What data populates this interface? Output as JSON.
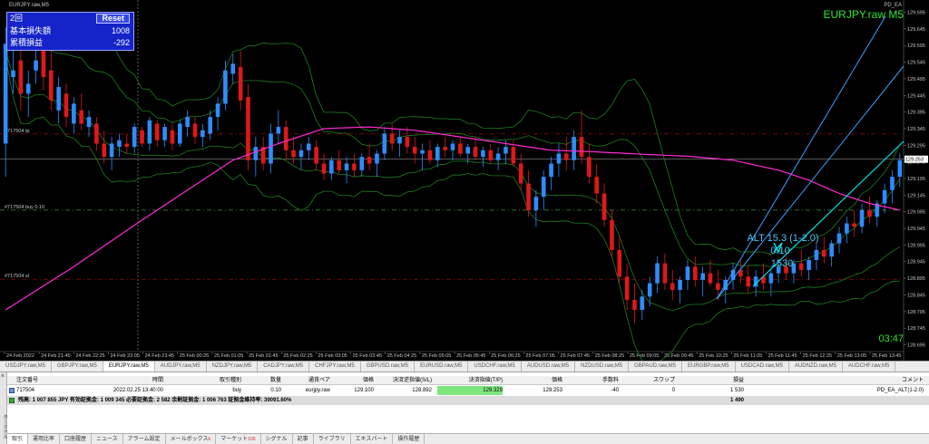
{
  "window": {
    "chart_title": "EURJPY.raw,M5",
    "ea_label": "PD_EA",
    "symbol_label": "EURJPY.raw M5",
    "clock": "03:47"
  },
  "info_panel": {
    "mode": "2回",
    "reset_label": "Reset",
    "rows": [
      {
        "label": "基本損失額",
        "value": "1008"
      },
      {
        "label": "累積損益",
        "value": "-292"
      }
    ]
  },
  "chart_annotations": {
    "alt_line1": "ALT 15.3 (1-2.0)",
    "alt_line2": "0.10",
    "alt_line3": "1530",
    "level_labels": [
      "#717504 tp",
      "#717504 buy 0.10",
      "#717504 sl"
    ]
  },
  "colors": {
    "candle_up": "#2f8cff",
    "candle_down": "#e01818",
    "ma": "#ff2ad4",
    "band": "#1f7d1f",
    "fan_light": "#3aa0ff",
    "fan_cyan": "#00e5e5",
    "level": "#b01010",
    "entry_level": "#3d9a3d"
  },
  "chart_data": {
    "type": "candlestick",
    "symbol": "EURJPY.raw",
    "timeframe": "M5",
    "y_ticks": [
      129.695,
      129.645,
      129.595,
      129.545,
      129.495,
      129.445,
      129.395,
      129.345,
      129.295,
      129.245,
      129.195,
      129.145,
      129.095,
      129.045,
      128.995,
      128.945,
      128.895,
      128.845,
      128.795,
      128.745,
      128.695
    ],
    "ylim": [
      128.68,
      129.71
    ],
    "current_price": 129.253,
    "current_price_label": "129.253",
    "levels": {
      "tp": 129.329,
      "entry": 129.1,
      "sl": 128.892
    },
    "x_ticks": [
      "24 Feb 2022",
      "24 Feb 21:45",
      "24 Feb 22:25",
      "24 Feb 23:05",
      "24 Feb 23:45",
      "25 Feb 00:25",
      "25 Feb 01:05",
      "25 Feb 01:45",
      "25 Feb 02:25",
      "25 Feb 03:05",
      "25 Feb 03:45",
      "25 Feb 04:25",
      "25 Feb 05:05",
      "25 Feb 05:45",
      "25 Feb 06:25",
      "25 Feb 07:05",
      "25 Feb 07:45",
      "25 Feb 08:25",
      "25 Feb 09:05",
      "25 Feb 09:45",
      "25 Feb 10:25",
      "25 Feb 11:05",
      "25 Feb 11:45",
      "25 Feb 12:25",
      "25 Feb 13:05",
      "25 Feb 13:45"
    ],
    "ma_key": [
      [
        0,
        128.8
      ],
      [
        9,
        128.93
      ],
      [
        18,
        129.07
      ],
      [
        24,
        129.16
      ],
      [
        30,
        129.25
      ],
      [
        36,
        129.3
      ],
      [
        42,
        129.345
      ],
      [
        48,
        129.35
      ],
      [
        54,
        129.34
      ],
      [
        60,
        129.32
      ],
      [
        66,
        129.3
      ],
      [
        72,
        129.28
      ],
      [
        78,
        129.275
      ],
      [
        84,
        129.268
      ],
      [
        90,
        129.262
      ],
      [
        96,
        129.25
      ],
      [
        102,
        129.22
      ],
      [
        106,
        129.19
      ],
      [
        110,
        129.15
      ],
      [
        114,
        129.12
      ],
      [
        118,
        129.1
      ],
      [
        123,
        129.095
      ]
    ],
    "candles": [
      [
        129.3,
        129.65,
        129.2,
        129.6
      ],
      [
        129.5,
        129.6,
        129.45,
        129.52
      ],
      [
        129.55,
        129.58,
        129.4,
        129.45
      ],
      [
        129.45,
        129.52,
        129.38,
        129.48
      ],
      [
        129.52,
        129.62,
        129.48,
        129.55
      ],
      [
        129.58,
        129.6,
        129.46,
        129.5
      ],
      [
        129.52,
        129.58,
        129.4,
        129.43
      ],
      [
        129.4,
        129.5,
        129.36,
        129.47
      ],
      [
        129.45,
        129.48,
        129.35,
        129.38
      ],
      [
        129.36,
        129.44,
        129.33,
        129.42
      ],
      [
        129.4,
        129.45,
        129.34,
        129.36
      ],
      [
        129.35,
        129.4,
        129.32,
        129.38
      ],
      [
        129.36,
        129.38,
        129.28,
        129.3
      ],
      [
        129.3,
        129.34,
        129.24,
        129.26
      ],
      [
        129.26,
        129.32,
        129.22,
        129.3
      ],
      [
        129.29,
        129.33,
        129.26,
        129.31
      ],
      [
        129.3,
        129.33,
        129.27,
        129.29
      ],
      [
        129.29,
        129.36,
        129.27,
        129.35
      ],
      [
        129.34,
        129.35,
        129.29,
        129.3
      ],
      [
        129.3,
        129.38,
        129.28,
        129.37
      ],
      [
        129.36,
        129.37,
        129.29,
        129.31
      ],
      [
        129.31,
        129.36,
        129.29,
        129.35
      ],
      [
        129.34,
        129.36,
        129.28,
        129.3
      ],
      [
        129.3,
        129.37,
        129.29,
        129.36
      ],
      [
        129.35,
        129.4,
        129.32,
        129.38
      ],
      [
        129.36,
        129.38,
        129.3,
        129.32
      ],
      [
        129.32,
        129.36,
        129.29,
        129.34
      ],
      [
        129.33,
        129.4,
        129.31,
        129.38
      ],
      [
        129.38,
        129.44,
        129.34,
        129.42
      ],
      [
        129.42,
        129.55,
        129.4,
        129.52
      ],
      [
        129.51,
        129.57,
        129.48,
        129.54
      ],
      [
        129.53,
        129.58,
        129.4,
        129.43
      ],
      [
        129.44,
        129.48,
        129.22,
        129.25
      ],
      [
        129.25,
        129.32,
        129.2,
        129.29
      ],
      [
        129.29,
        129.32,
        129.22,
        129.24
      ],
      [
        129.24,
        129.36,
        129.21,
        129.33
      ],
      [
        129.33,
        129.4,
        129.3,
        129.35
      ],
      [
        129.35,
        129.37,
        129.25,
        129.28
      ],
      [
        129.28,
        129.32,
        129.24,
        129.26
      ],
      [
        129.26,
        129.3,
        129.22,
        129.28
      ],
      [
        129.28,
        129.32,
        129.25,
        129.3
      ],
      [
        129.29,
        129.31,
        129.22,
        129.24
      ],
      [
        129.24,
        129.27,
        129.19,
        129.21
      ],
      [
        129.21,
        129.26,
        129.19,
        129.25
      ],
      [
        129.25,
        129.28,
        129.21,
        129.22
      ],
      [
        129.22,
        129.26,
        129.18,
        129.24
      ],
      [
        129.24,
        129.27,
        129.2,
        129.22
      ],
      [
        129.22,
        129.27,
        129.2,
        129.26
      ],
      [
        129.26,
        129.3,
        129.22,
        129.24
      ],
      [
        129.24,
        129.28,
        129.2,
        129.27
      ],
      [
        129.27,
        129.35,
        129.25,
        129.33
      ],
      [
        129.33,
        129.36,
        129.28,
        129.3
      ],
      [
        129.3,
        129.34,
        129.26,
        129.32
      ],
      [
        129.32,
        129.35,
        129.27,
        129.29
      ],
      [
        129.29,
        129.32,
        129.24,
        129.27
      ],
      [
        129.27,
        129.3,
        129.22,
        129.28
      ],
      [
        129.28,
        129.31,
        129.24,
        129.25
      ],
      [
        129.25,
        129.3,
        129.23,
        129.29
      ],
      [
        129.29,
        129.32,
        129.26,
        129.28
      ],
      [
        129.28,
        129.31,
        129.25,
        129.3
      ],
      [
        129.3,
        129.32,
        129.26,
        129.27
      ],
      [
        129.27,
        129.3,
        129.24,
        129.29
      ],
      [
        129.29,
        129.32,
        129.25,
        129.26
      ],
      [
        129.26,
        129.29,
        129.23,
        129.28
      ],
      [
        129.28,
        129.3,
        129.24,
        129.25
      ],
      [
        129.25,
        129.29,
        129.22,
        129.27
      ],
      [
        129.27,
        129.31,
        129.24,
        129.29
      ],
      [
        129.29,
        129.31,
        129.23,
        129.24
      ],
      [
        129.24,
        129.27,
        129.16,
        129.18
      ],
      [
        129.18,
        129.22,
        129.08,
        129.1
      ],
      [
        129.1,
        129.16,
        129.05,
        129.14
      ],
      [
        129.14,
        129.22,
        129.1,
        129.2
      ],
      [
        129.2,
        129.26,
        129.16,
        129.24
      ],
      [
        129.24,
        129.3,
        129.2,
        129.27
      ],
      [
        129.27,
        129.32,
        129.22,
        129.25
      ],
      [
        129.25,
        129.34,
        129.22,
        129.32
      ],
      [
        129.32,
        129.4,
        129.24,
        129.26
      ],
      [
        129.26,
        129.3,
        129.18,
        129.2
      ],
      [
        129.2,
        129.24,
        129.12,
        129.15
      ],
      [
        129.15,
        129.18,
        129.05,
        129.07
      ],
      [
        129.07,
        129.1,
        128.96,
        128.98
      ],
      [
        128.98,
        129.02,
        128.88,
        128.9
      ],
      [
        128.9,
        128.94,
        128.8,
        128.83
      ],
      [
        128.83,
        128.88,
        128.76,
        128.8
      ],
      [
        128.8,
        128.86,
        128.77,
        128.84
      ],
      [
        128.84,
        128.9,
        128.81,
        128.88
      ],
      [
        128.88,
        128.96,
        128.85,
        128.94
      ],
      [
        128.94,
        128.97,
        128.86,
        128.88
      ],
      [
        128.88,
        128.92,
        128.83,
        128.86
      ],
      [
        128.86,
        128.9,
        128.82,
        128.89
      ],
      [
        128.89,
        128.95,
        128.86,
        128.93
      ],
      [
        128.93,
        128.96,
        128.87,
        128.89
      ],
      [
        128.89,
        128.93,
        128.84,
        128.91
      ],
      [
        128.91,
        128.95,
        128.87,
        128.88
      ],
      [
        128.88,
        128.92,
        128.83,
        128.86
      ],
      [
        128.86,
        128.9,
        128.82,
        128.89
      ],
      [
        128.89,
        128.94,
        128.86,
        128.92
      ],
      [
        128.92,
        128.95,
        128.88,
        128.9
      ],
      [
        128.9,
        128.93,
        128.85,
        128.87
      ],
      [
        128.87,
        128.92,
        128.84,
        128.9
      ],
      [
        128.9,
        128.94,
        128.86,
        128.88
      ],
      [
        128.88,
        128.92,
        128.84,
        128.91
      ],
      [
        128.91,
        128.95,
        128.88,
        128.93
      ],
      [
        128.93,
        128.96,
        128.89,
        128.91
      ],
      [
        128.91,
        128.95,
        128.88,
        128.94
      ],
      [
        128.94,
        128.98,
        128.9,
        128.92
      ],
      [
        128.92,
        128.96,
        128.89,
        128.95
      ],
      [
        128.95,
        129.0,
        128.92,
        128.98
      ],
      [
        128.98,
        129.02,
        128.94,
        128.96
      ],
      [
        128.96,
        129.01,
        128.93,
        129.0
      ],
      [
        129.0,
        129.05,
        128.97,
        129.03
      ],
      [
        129.03,
        129.08,
        129.0,
        129.06
      ],
      [
        129.06,
        129.1,
        129.02,
        129.05
      ],
      [
        129.05,
        129.12,
        129.03,
        129.1
      ],
      [
        129.1,
        129.14,
        129.06,
        129.08
      ],
      [
        129.08,
        129.13,
        129.05,
        129.12
      ],
      [
        129.12,
        129.18,
        129.09,
        129.16
      ],
      [
        129.16,
        129.22,
        129.12,
        129.2
      ],
      [
        129.2,
        129.27,
        129.17,
        129.25
      ]
    ]
  },
  "symbol_tabs": [
    "USDJPY.raw,M5",
    "GBPJPY.raw,M5",
    "EURJPY.raw,M5",
    "AUDJPY.raw,M5",
    "NZDJPY.raw,M5",
    "CADJPY.raw,M5",
    "CHFJPY.raw,M5",
    "GBPUSD.raw,M5",
    "EURUSD.raw,M5",
    "USDCHF.raw,M5",
    "AUDUSD.raw,M5",
    "NZDUSD.raw,M5",
    "GBPAUD.raw,M5",
    "EURGBP.raw,M5",
    "USDCAD.raw,M5",
    "AUDNZD.raw,M5",
    "AUDCHF.raw,M5"
  ],
  "orders_header": [
    "注文番号",
    "時間",
    "取引種別",
    "数量",
    "通貨ペア",
    "価格",
    "決済逆指値(S/L)",
    "決済指値(T/P)",
    "価格",
    "手数料",
    "スワップ",
    "損益",
    "コメント"
  ],
  "order_row": [
    "717504",
    "2022.02.25 13:40:00",
    "buy",
    "0.10",
    "eurjpy.raw",
    "129.100",
    "128.892",
    "129.329",
    "129.253",
    "-40",
    "0",
    "1 530",
    "PD_EA_ALT(1-2.0)"
  ],
  "summary": {
    "text": "残高: 1 007 855 JPY  有効証拠金: 1 009 345  必要証拠金: 2 582  余剰証拠金: 1 006 763  証拠金維持率: 39091.60%",
    "total": "1 490"
  },
  "terminal_label": "ターミナル",
  "bottom_tabs": [
    {
      "label": "取引",
      "badge": ""
    },
    {
      "label": "運用比率",
      "badge": ""
    },
    {
      "label": "口座履歴",
      "badge": ""
    },
    {
      "label": "ニュース",
      "badge": ""
    },
    {
      "label": "アラーム設定",
      "badge": ""
    },
    {
      "label": "メールボックス",
      "badge": "6"
    },
    {
      "label": "マーケット",
      "badge": "100"
    },
    {
      "label": "シグナル",
      "badge": ""
    },
    {
      "label": "記事",
      "badge": ""
    },
    {
      "label": "ライブラリ",
      "badge": ""
    },
    {
      "label": "エキスパート",
      "badge": ""
    },
    {
      "label": "操作履歴",
      "badge": ""
    }
  ]
}
